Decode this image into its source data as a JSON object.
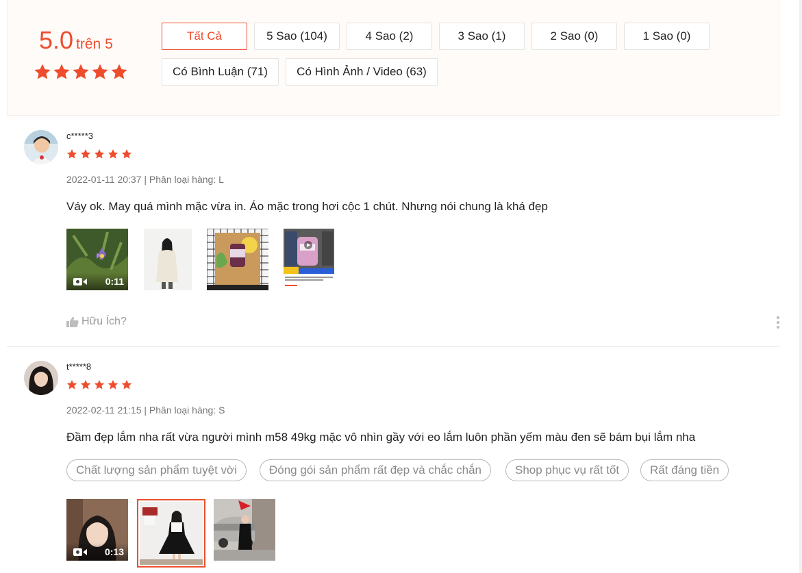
{
  "rating_overview": {
    "score": "5.0",
    "score_suffix": "trên 5",
    "stars": 5
  },
  "filters": [
    {
      "label": "Tất Cả",
      "active": true
    },
    {
      "label": "5 Sao (104)"
    },
    {
      "label": "4 Sao (2)"
    },
    {
      "label": "3 Sao (1)"
    },
    {
      "label": "2 Sao (0)"
    },
    {
      "label": "1 Sao (0)"
    },
    {
      "label": "Có Bình Luận (71)"
    },
    {
      "label": "Có Hình Ảnh / Video (63)"
    }
  ],
  "reviews": [
    {
      "username": "c*****3",
      "stars": 5,
      "meta": "2022-01-11 20:37 | Phân loại hàng: L",
      "comment": "Váy ok. May quá mình mặc vừa in. Áo mặc trong hơi cộc 1 chút. Nhưng nói chung là khá đẹp",
      "media": [
        {
          "type": "video",
          "duration": "0:11"
        },
        {
          "type": "image"
        },
        {
          "type": "image"
        },
        {
          "type": "image"
        }
      ],
      "helpful_label": "Hữu Ích?"
    },
    {
      "username": "t*****8",
      "stars": 5,
      "meta": "2022-02-11 21:15 | Phân loại hàng: S",
      "comment": "Đầm đẹp lắm nha rất vừa người mình m58 49kg mặc vô nhìn gầy với eo lắm luôn phần yếm màu đen sẽ bám bụi lắm nha",
      "tags": [
        "Chất lượng sản phẩm tuyệt vời",
        "Đóng gói sản phẩm rất đẹp và chắc chắn",
        "Shop phục vụ rất tốt",
        "Rất đáng tiền"
      ],
      "media": [
        {
          "type": "video",
          "duration": "0:13"
        },
        {
          "type": "image",
          "selected": true
        },
        {
          "type": "image"
        }
      ]
    }
  ],
  "colors": {
    "accent": "#ee4d2d",
    "overview_bg": "#fffbf8"
  }
}
